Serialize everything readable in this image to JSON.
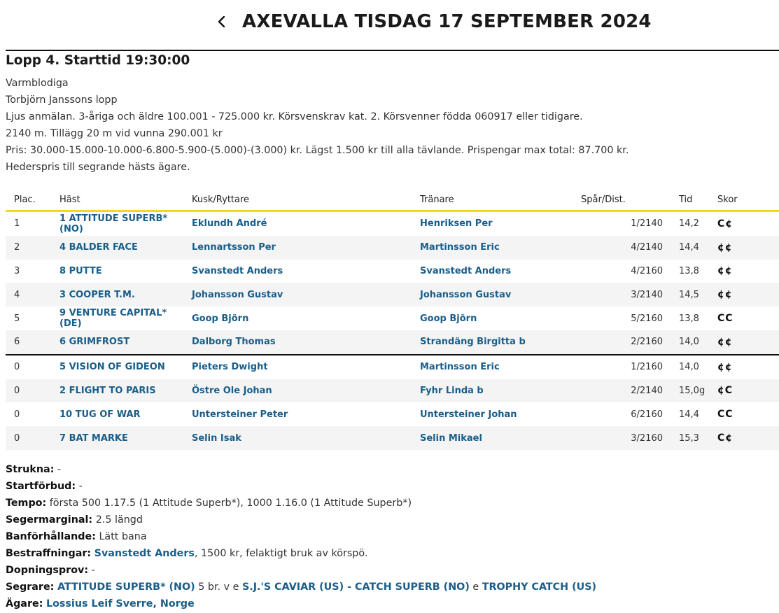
{
  "header": {
    "title": "AXEVALLA TISDAG 17 SEPTEMBER 2024"
  },
  "race": {
    "title": "Lopp 4. Starttid 19:30:00",
    "info": [
      "Varmblodiga",
      "Torbjörn Janssons lopp",
      "Ljus anmälan. 3-åriga och äldre 100.001 - 725.000 kr. Körsvenskrav kat. 2. Körsvenner födda 060917 eller tidigare.",
      "2140 m. Tillägg 20 m vid vunna 290.001 kr",
      "Pris: 30.000-15.000-10.000-6.800-5.900-(5.000)-(3.000) kr. Lägst 1.500 kr till alla tävlande. Prispengar max total: 87.700 kr.",
      "Hederspris till segrande hästs ägare."
    ]
  },
  "table": {
    "headers": {
      "plac": "Plac.",
      "hast": "Häst",
      "kusk": "Kusk/Ryttare",
      "tranare": "Tränare",
      "spar": "Spår/Dist.",
      "tid": "Tid",
      "skor": "Skor"
    },
    "rows": [
      {
        "plac": "1",
        "hast": "1 ATTITUDE SUPERB* (NO)",
        "kusk": "Eklundh André",
        "tranare": "Henriksen Per",
        "spar": "1/2140",
        "tid": "14,2",
        "skor": "C¢"
      },
      {
        "plac": "2",
        "hast": "4 BALDER FACE",
        "kusk": "Lennartsson Per",
        "tranare": "Martinsson Eric",
        "spar": "4/2140",
        "tid": "14,4",
        "skor": "¢¢"
      },
      {
        "plac": "3",
        "hast": "8 PUTTE",
        "kusk": "Svanstedt Anders",
        "tranare": "Svanstedt Anders",
        "spar": "4/2160",
        "tid": "13,8",
        "skor": "¢¢"
      },
      {
        "plac": "4",
        "hast": "3 COOPER T.M.",
        "kusk": "Johansson Gustav",
        "tranare": "Johansson Gustav",
        "spar": "3/2140",
        "tid": "14,5",
        "skor": "¢¢"
      },
      {
        "plac": "5",
        "hast": "9 VENTURE CAPITAL* (DE)",
        "kusk": "Goop Björn",
        "tranare": "Goop Björn",
        "spar": "5/2160",
        "tid": "13,8",
        "skor": "CC"
      },
      {
        "plac": "6",
        "hast": "6 GRIMFROST",
        "kusk": "Dalborg Thomas",
        "tranare": "Strandäng Birgitta b",
        "spar": "2/2160",
        "tid": "14,0",
        "skor": "¢¢"
      },
      {
        "plac": "0",
        "hast": "5 VISION OF GIDEON",
        "kusk": "Pieters Dwight",
        "tranare": "Martinsson Eric",
        "spar": "1/2160",
        "tid": "14,0",
        "skor": "¢¢"
      },
      {
        "plac": "0",
        "hast": "2 FLIGHT TO PARIS",
        "kusk": "Östre Ole Johan",
        "tranare": "Fyhr Linda b",
        "spar": "2/2140",
        "tid": "15,0g",
        "skor": "¢C"
      },
      {
        "plac": "0",
        "hast": "10 TUG OF WAR",
        "kusk": "Untersteiner Peter",
        "tranare": "Untersteiner Johan",
        "spar": "6/2160",
        "tid": "14,4",
        "skor": "CC"
      },
      {
        "plac": "0",
        "hast": "7 BAT MARKE",
        "kusk": "Selin Isak",
        "tranare": "Selin Mikael",
        "spar": "3/2160",
        "tid": "15,3",
        "skor": "C¢"
      }
    ]
  },
  "details": {
    "strukna_label": "Strukna:",
    "strukna": " -",
    "startforbud_label": "Startförbud:",
    "startforbud": " -",
    "tempo_label": "Tempo:",
    "tempo": " första 500 1.17.5 (1 Attitude Superb*), 1000 1.16.0 (1 Attitude Superb*)",
    "segermarginal_label": "Segermarginal:",
    "segermarginal": " 2.5 längd",
    "banforhallande_label": "Banförhållande:",
    "banforhallande": " Lätt bana",
    "bestraffningar_label": "Bestraffningar:",
    "bestraffningar_link": "Svanstedt Anders",
    "bestraffningar_text": ", 1500 kr, felaktigt bruk av körspö.",
    "dopningsprov_label": "Dopningsprov:",
    "dopningsprov": " -",
    "segrare_label": "Segrare:",
    "segrare_horse": "ATTITUDE SUPERB* (NO)",
    "segrare_mid": " 5 br. v e ",
    "segrare_sire": "S.J.'S CAVIAR (US)",
    "segrare_dash": " - ",
    "segrare_dam": "CATCH SUPERB (NO)",
    "segrare_e": " e ",
    "segrare_damsire": "TROPHY CATCH (US)",
    "agare_label": "Ägare:",
    "agare": "Lossius Leif Sverre, Norge"
  },
  "colors": {
    "link": "#1a5e89",
    "accent": "#f2d81f"
  }
}
